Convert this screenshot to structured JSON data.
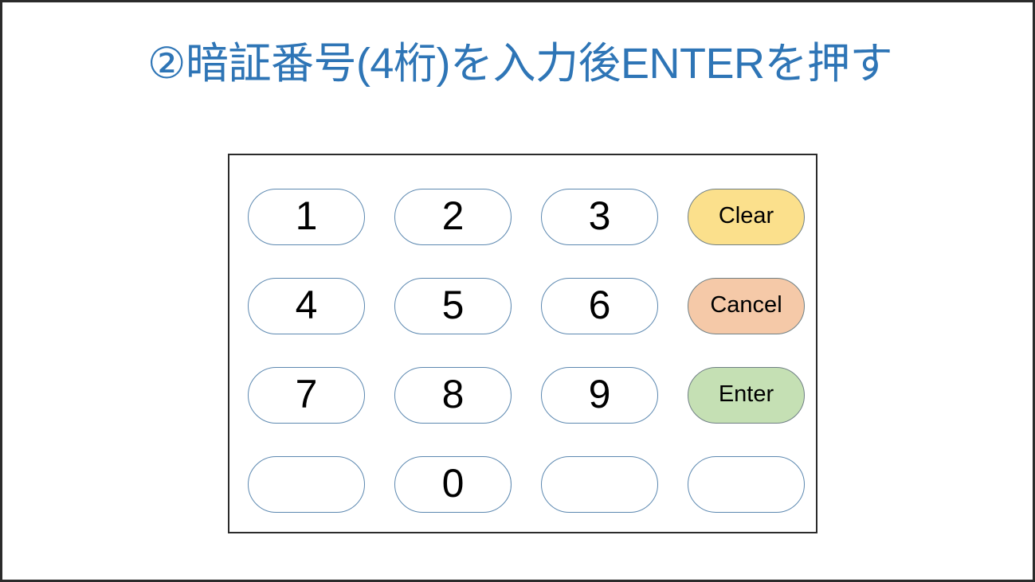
{
  "slide": {
    "title": "②暗証番号(4桁)を入力後ENTERを押す",
    "title_color": "#2e75b6",
    "background_color": "#ffffff",
    "border_color": "#2b2b2b"
  },
  "keypad": {
    "frame_border_color": "#2b2b2b",
    "digit_key": {
      "fill": "#ffffff",
      "border": "#5c88b0",
      "text_color": "#000000"
    },
    "action_key_border": "#6f7f84",
    "rows": [
      [
        {
          "name": "key-1",
          "label": "1",
          "kind": "digit",
          "fill": "#ffffff"
        },
        {
          "name": "key-2",
          "label": "2",
          "kind": "digit",
          "fill": "#ffffff"
        },
        {
          "name": "key-3",
          "label": "3",
          "kind": "digit",
          "fill": "#ffffff"
        },
        {
          "name": "key-clear",
          "label": "Clear",
          "kind": "action",
          "fill": "#fbe08c"
        }
      ],
      [
        {
          "name": "key-4",
          "label": "4",
          "kind": "digit",
          "fill": "#ffffff"
        },
        {
          "name": "key-5",
          "label": "5",
          "kind": "digit",
          "fill": "#ffffff"
        },
        {
          "name": "key-6",
          "label": "6",
          "kind": "digit",
          "fill": "#ffffff"
        },
        {
          "name": "key-cancel",
          "label": "Cancel",
          "kind": "action",
          "fill": "#f5c9a8"
        }
      ],
      [
        {
          "name": "key-7",
          "label": "7",
          "kind": "digit",
          "fill": "#ffffff"
        },
        {
          "name": "key-8",
          "label": "8",
          "kind": "digit",
          "fill": "#ffffff"
        },
        {
          "name": "key-9",
          "label": "9",
          "kind": "digit",
          "fill": "#ffffff"
        },
        {
          "name": "key-enter",
          "label": "Enter",
          "kind": "action",
          "fill": "#c5e0b4"
        }
      ],
      [
        {
          "name": "key-blank-1",
          "label": "",
          "kind": "blank",
          "fill": "#ffffff"
        },
        {
          "name": "key-0",
          "label": "0",
          "kind": "digit",
          "fill": "#ffffff"
        },
        {
          "name": "key-blank-2",
          "label": "",
          "kind": "blank",
          "fill": "#ffffff"
        },
        {
          "name": "key-blank-3",
          "label": "",
          "kind": "blank",
          "fill": "#ffffff"
        }
      ]
    ]
  }
}
